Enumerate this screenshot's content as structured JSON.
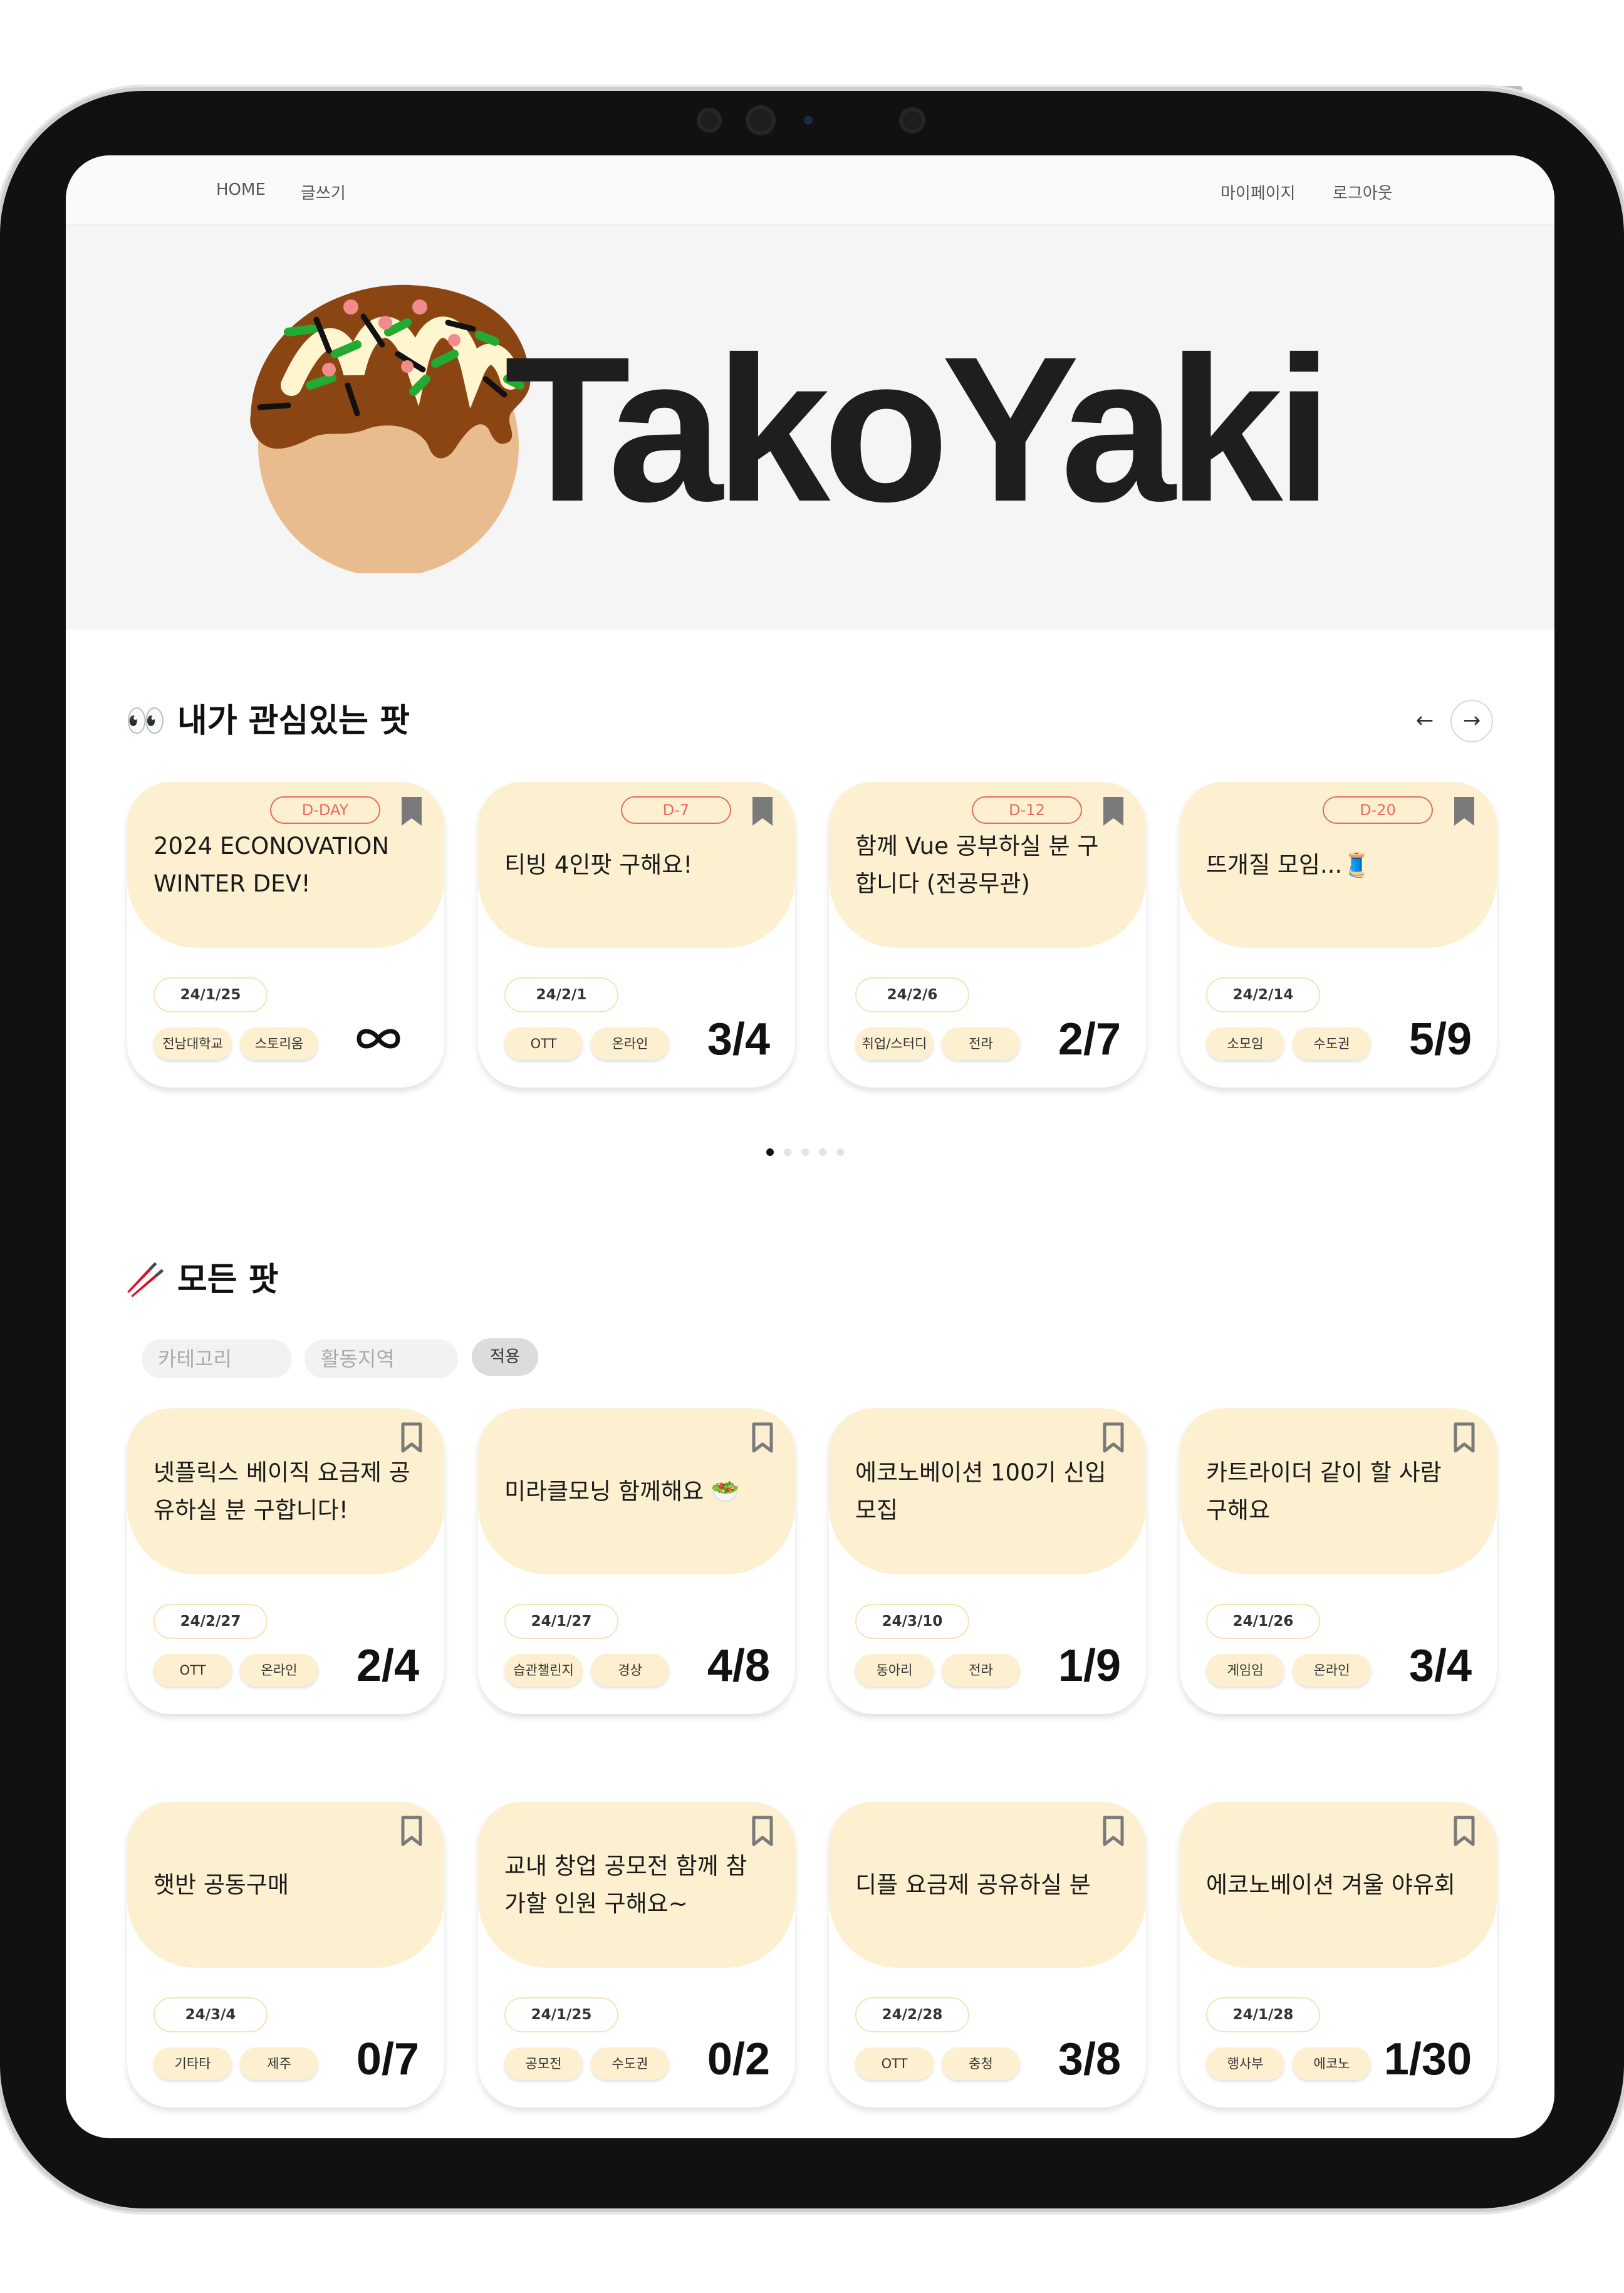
{
  "nav": {
    "home": "HOME",
    "write": "글쓰기",
    "mypage": "마이페이지",
    "logout": "로그아웃"
  },
  "hero": {
    "title": "TakoYaki"
  },
  "interest": {
    "title": "👀 내가 관심있는 팟",
    "prev_icon": "←",
    "next_icon": "→",
    "cards": [
      {
        "dday": "D-DAY",
        "title": "2024 ECONOVATION WINTER DEV!",
        "date": "24/1/25",
        "tags": [
          "전남대학교",
          "스토리움"
        ],
        "count": "∞"
      },
      {
        "dday": "D-7",
        "title": "티빙 4인팟 구해요!",
        "date": "24/2/1",
        "tags": [
          "OTT",
          "온라인"
        ],
        "count": "3/4"
      },
      {
        "dday": "D-12",
        "title": "함께 Vue 공부하실 분 구합니다 (전공무관)",
        "date": "24/2/6",
        "tags": [
          "취업/스터디",
          "전라"
        ],
        "count": "2/7"
      },
      {
        "dday": "D-20",
        "title": "뜨개질 모임...🧵",
        "date": "24/2/14",
        "tags": [
          "소모임",
          "수도권"
        ],
        "count": "5/9"
      }
    ]
  },
  "all": {
    "title": "🥢 모든 팟",
    "filter_category": "카테고리",
    "filter_region": "활동지역",
    "apply": "적용",
    "cards": [
      {
        "title": "넷플릭스 베이직 요금제 공유하실 분 구합니다!",
        "date": "24/2/27",
        "tags": [
          "OTT",
          "온라인"
        ],
        "count": "2/4"
      },
      {
        "title": "미라클모닝 함께해요 🥗",
        "date": "24/1/27",
        "tags": [
          "습관챌린지",
          "경상"
        ],
        "count": "4/8"
      },
      {
        "title": "에코노베이션 100기 신입 모집",
        "date": "24/3/10",
        "tags": [
          "동아리",
          "전라"
        ],
        "count": "1/9"
      },
      {
        "title": "카트라이더 같이 할 사람 구해요",
        "date": "24/1/26",
        "tags": [
          "게임임",
          "온라인"
        ],
        "count": "3/4"
      },
      {
        "title": "햇반 공동구매",
        "date": "24/3/4",
        "tags": [
          "기타타",
          "제주"
        ],
        "count": "0/7"
      },
      {
        "title": "교내 창업 공모전 함께 참가할 인원 구해요~",
        "date": "24/1/25",
        "tags": [
          "공모전",
          "수도권"
        ],
        "count": "0/2"
      },
      {
        "title": "디플 요금제 공유하실 분",
        "date": "24/2/28",
        "tags": [
          "OTT",
          "충청"
        ],
        "count": "3/8"
      },
      {
        "title": "에코노베이션 겨울 야유회",
        "date": "24/1/28",
        "tags": [
          "행사부",
          "에코노"
        ],
        "count": "1/30"
      }
    ]
  },
  "colors": {
    "card_top": "#fdf0d0",
    "dday_red": "#e46b66",
    "bookmark": "#7a7a7a"
  },
  "icons": {
    "bookmark": "bookmark-icon",
    "infinity": "infinity-icon",
    "prev": "arrow-left-icon",
    "next": "arrow-right-icon",
    "logo": "takoyaki-logo"
  }
}
